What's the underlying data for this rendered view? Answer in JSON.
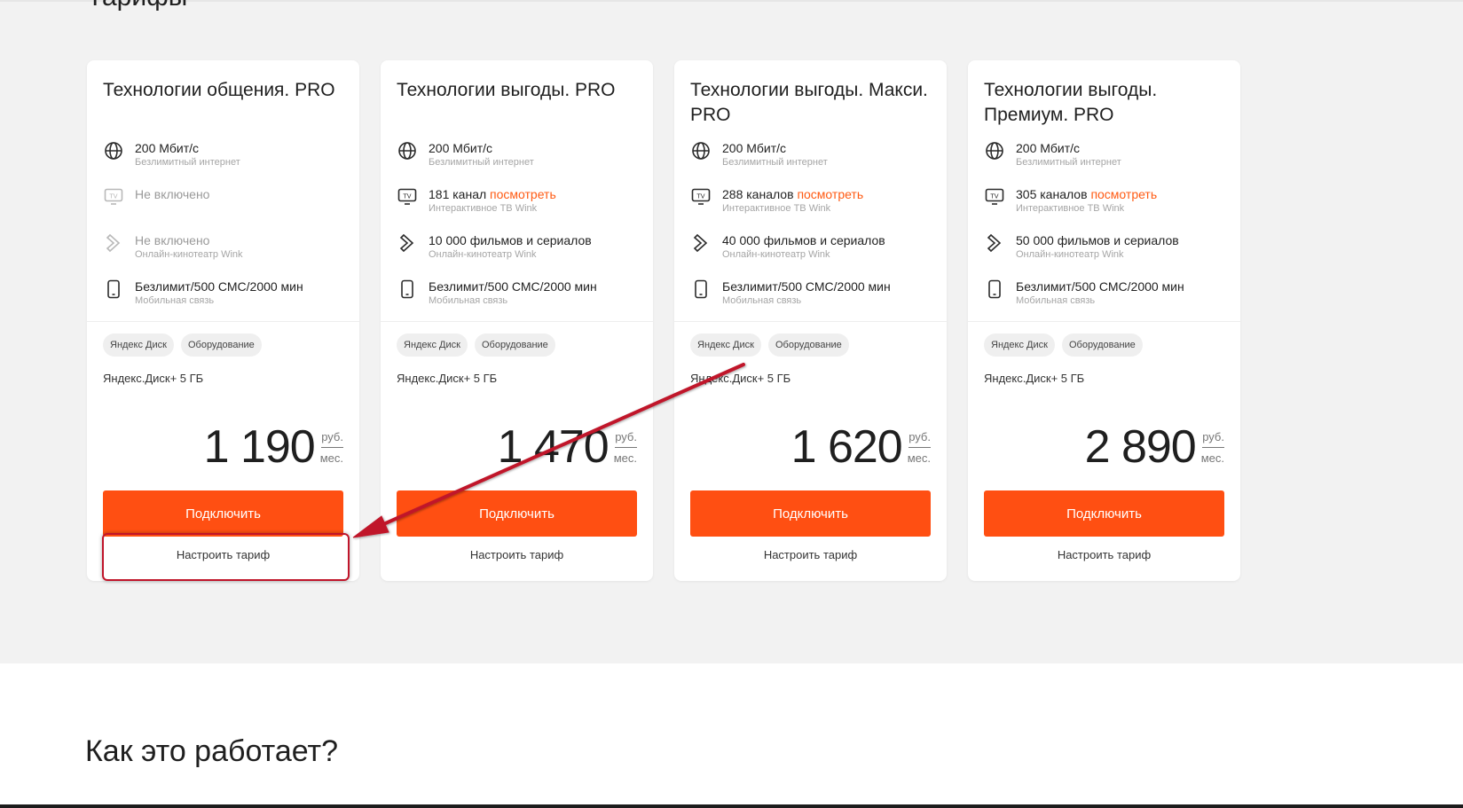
{
  "section": {
    "title": "Тарифы"
  },
  "tariffs": [
    {
      "title": "Технологии общения. PRO",
      "features": [
        {
          "icon": "globe-icon",
          "main": "200 Мбит/с",
          "sub": "Безлимитный интернет",
          "muted": false
        },
        {
          "icon": "tv-icon",
          "main": "Не включено",
          "sub": "",
          "muted": true
        },
        {
          "icon": "play-icon",
          "main": "Не включено",
          "sub": "Онлайн-кинотеатр Wink",
          "muted": true
        },
        {
          "icon": "phone-icon",
          "main": "Безлимит/500 СМС/2000 мин",
          "sub": "Мобильная связь",
          "muted": false
        }
      ],
      "chips": [
        "Яндекс Диск",
        "Оборудование"
      ],
      "extra": "Яндекс.Диск+ 5 ГБ",
      "price": "1 190",
      "currency": "руб.",
      "period": "мес.",
      "connect_label": "Подключить",
      "configure_label": "Настроить тариф"
    },
    {
      "title": "Технологии выгоды. PRO",
      "features": [
        {
          "icon": "globe-icon",
          "main": "200 Мбит/с",
          "sub": "Безлимитный интернет",
          "muted": false
        },
        {
          "icon": "tv-icon",
          "main": "181 канал",
          "link": "посмотреть",
          "sub": "Интерактивное ТВ Wink",
          "muted": false
        },
        {
          "icon": "play-icon",
          "main": "10 000 фильмов и сериалов",
          "sub": "Онлайн-кинотеатр Wink",
          "muted": false
        },
        {
          "icon": "phone-icon",
          "main": "Безлимит/500 СМС/2000 мин",
          "sub": "Мобильная связь",
          "muted": false
        }
      ],
      "chips": [
        "Яндекс Диск",
        "Оборудование"
      ],
      "extra": "Яндекс.Диск+ 5 ГБ",
      "price": "1 470",
      "currency": "руб.",
      "period": "мес.",
      "connect_label": "Подключить",
      "configure_label": "Настроить тариф"
    },
    {
      "title": "Технологии выгоды. Макси. PRO",
      "features": [
        {
          "icon": "globe-icon",
          "main": "200 Мбит/с",
          "sub": "Безлимитный интернет",
          "muted": false
        },
        {
          "icon": "tv-icon",
          "main": "288 каналов",
          "link": "посмотреть",
          "sub": "Интерактивное ТВ Wink",
          "muted": false
        },
        {
          "icon": "play-icon",
          "main": "40 000 фильмов и сериалов",
          "sub": "Онлайн-кинотеатр Wink",
          "muted": false
        },
        {
          "icon": "phone-icon",
          "main": "Безлимит/500 СМС/2000 мин",
          "sub": "Мобильная связь",
          "muted": false
        }
      ],
      "chips": [
        "Яндекс Диск",
        "Оборудование"
      ],
      "extra": "Яндекс.Диск+ 5 ГБ",
      "price": "1 620",
      "currency": "руб.",
      "period": "мес.",
      "connect_label": "Подключить",
      "configure_label": "Настроить тариф"
    },
    {
      "title": "Технологии выгоды. Премиум. PRO",
      "features": [
        {
          "icon": "globe-icon",
          "main": "200 Мбит/с",
          "sub": "Безлимитный интернет",
          "muted": false
        },
        {
          "icon": "tv-icon",
          "main": "305 каналов",
          "link": "посмотреть",
          "sub": "Интерактивное ТВ Wink",
          "muted": false
        },
        {
          "icon": "play-icon",
          "main": "50 000 фильмов и сериалов",
          "sub": "Онлайн-кинотеатр Wink",
          "muted": false
        },
        {
          "icon": "phone-icon",
          "main": "Безлимит/500 СМС/2000 мин",
          "sub": "Мобильная связь",
          "muted": false
        }
      ],
      "chips": [
        "Яндекс Диск",
        "Оборудование"
      ],
      "extra": "Яндекс.Диск+ 5 ГБ",
      "price": "2 890",
      "currency": "руб.",
      "period": "мес.",
      "connect_label": "Подключить",
      "configure_label": "Настроить тариф"
    }
  ],
  "how_it_works": {
    "title": "Как это работает?"
  },
  "colors": {
    "accent": "#ff4f12",
    "link": "#ff5a12",
    "annotation": "#c0152a"
  }
}
